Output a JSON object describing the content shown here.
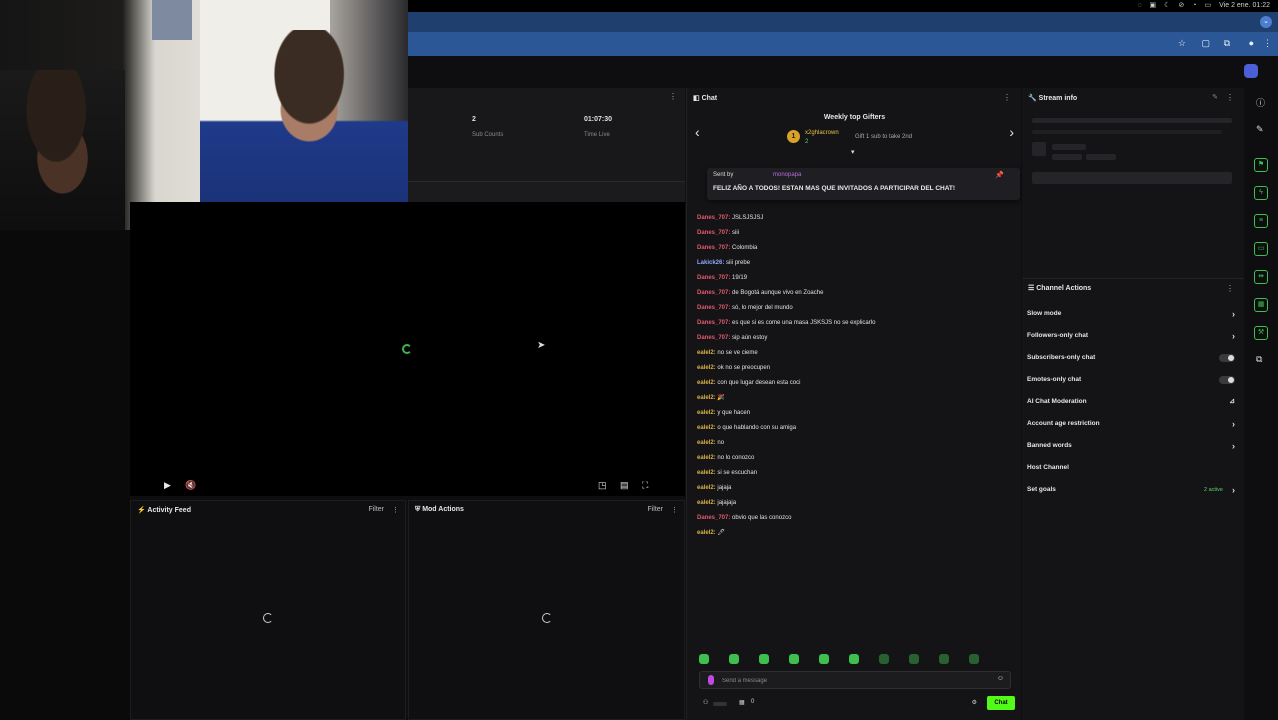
{
  "os_bar": {
    "clock": "Vie 2 ene. 01:22"
  },
  "stats": {
    "items": [
      {
        "value": "2",
        "label": "Sub Counts"
      },
      {
        "value": "01:07:30",
        "label": "Time Live"
      }
    ]
  },
  "activity_feed": {
    "title": "Activity Feed",
    "filter": "Filter"
  },
  "mod_actions": {
    "title": "Mod Actions",
    "filter": "Filter"
  },
  "chat": {
    "title": "Chat",
    "gifters": {
      "title": "Weekly top Gifters",
      "rank": "1",
      "name": "x2ghlacrown",
      "subs": "2",
      "gift_text": "Gift 1 sub to take 2nd"
    },
    "pinned": {
      "sent_by": "Sent by",
      "sender": "monopapa",
      "message": "FELIZ AÑO A TODOS! ESTAN MAS QUE INVITADOS A PARTICIPAR DEL CHAT!"
    },
    "messages": [
      {
        "user": "Danes_707:",
        "text": "JSLSJSJSJ",
        "color": "#e0596f"
      },
      {
        "user": "Danes_707:",
        "text": "siii",
        "color": "#e0596f"
      },
      {
        "user": "Danes_707:",
        "text": "Colombia",
        "color": "#e0596f"
      },
      {
        "user": "Lakick26:",
        "text": "siii prebe",
        "color": "#8fa7ff"
      },
      {
        "user": "Danes_707:",
        "text": "19/19",
        "color": "#e0596f"
      },
      {
        "user": "Danes_707:",
        "text": "de Bogotá aunque vivo en Zoache",
        "color": "#e0596f"
      },
      {
        "user": "Danes_707:",
        "text": "só, lo mejor del mundo",
        "color": "#e0596f"
      },
      {
        "user": "Danes_707:",
        "text": "es que si es come una masa JSKSJS no se explicarlo",
        "color": "#e0596f"
      },
      {
        "user": "Danes_707:",
        "text": "sip aún estoy",
        "color": "#e0596f"
      },
      {
        "user": "ealel2:",
        "text": "no se ve cieme",
        "color": "#d9b24a"
      },
      {
        "user": "ealel2:",
        "text": "ok no se preocupen",
        "color": "#d9b24a"
      },
      {
        "user": "ealel2:",
        "text": "con que lugar desean esta coci",
        "color": "#d9b24a"
      },
      {
        "user": "ealel2:",
        "text": "🎉",
        "color": "#d9b24a"
      },
      {
        "user": "ealel2:",
        "text": "y que hacen",
        "color": "#d9b24a"
      },
      {
        "user": "ealel2:",
        "text": "o que hablando con su amiga",
        "color": "#d9b24a"
      },
      {
        "user": "ealel2:",
        "text": "no",
        "color": "#d9b24a"
      },
      {
        "user": "ealel2:",
        "text": "no lo conozco",
        "color": "#d9b24a"
      },
      {
        "user": "ealel2:",
        "text": "si se escuchan",
        "color": "#d9b24a"
      },
      {
        "user": "ealel2:",
        "text": "jajaja",
        "color": "#d9b24a"
      },
      {
        "user": "ealel2:",
        "text": "jajajaja",
        "color": "#d9b24a"
      },
      {
        "user": "Danes_707:",
        "text": "obvio que las conozco",
        "color": "#e0596f"
      },
      {
        "user": "ealel2:",
        "text": "🖊",
        "color": "#d9b24a"
      }
    ],
    "input_placeholder": "Send a message",
    "footer_count": "0",
    "send_label": "Chat"
  },
  "stream_info": {
    "title": "Stream info"
  },
  "channel_actions": {
    "title": "Channel Actions",
    "items": [
      {
        "label": "Slow mode",
        "control": "chevron"
      },
      {
        "label": "Followers-only chat",
        "control": "chevron"
      },
      {
        "label": "Subscribers-only chat",
        "control": "toggle"
      },
      {
        "label": "Emotes-only chat",
        "control": "toggle"
      },
      {
        "label": "AI Chat Moderation",
        "control": "chart"
      },
      {
        "label": "Account age restriction",
        "control": "chevron"
      },
      {
        "label": "Banned words",
        "control": "chevron"
      },
      {
        "label": "Host Channel",
        "control": "none"
      },
      {
        "label": "Set goals",
        "control": "chevron",
        "extra": "2 active"
      }
    ]
  },
  "icons": [
    "play-icon",
    "mute-icon",
    "pip-icon",
    "theater-icon",
    "fullscreen-icon",
    "pin-icon",
    "gear-icon",
    "chevron-right-icon",
    "kebab-icon"
  ],
  "colors": {
    "accent": "#53fc18",
    "chat_bg": "#141416",
    "tab_bar": "#1f3f6e",
    "address_bar": "#2c5797"
  }
}
